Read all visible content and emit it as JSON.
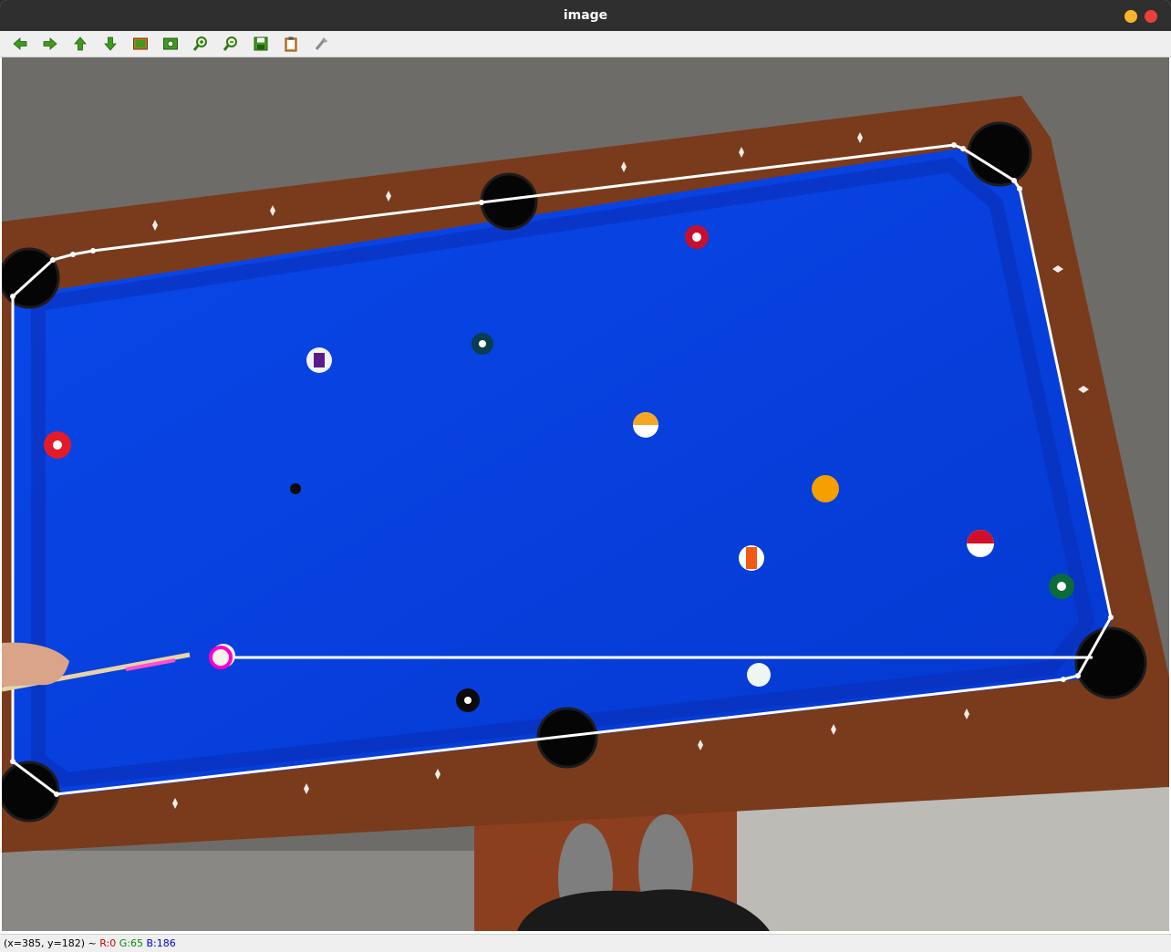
{
  "window": {
    "title": "image"
  },
  "toolbar": {
    "buttons": [
      {
        "name": "pan-left",
        "icon": "arrow-left-icon"
      },
      {
        "name": "pan-right",
        "icon": "arrow-right-icon"
      },
      {
        "name": "pan-up",
        "icon": "arrow-up-icon"
      },
      {
        "name": "pan-down",
        "icon": "arrow-down-icon"
      },
      {
        "name": "zoom-fit",
        "icon": "image-icon"
      },
      {
        "name": "zoom-original",
        "icon": "image-zoom-icon"
      },
      {
        "name": "zoom-in",
        "icon": "zoom-in-icon"
      },
      {
        "name": "zoom-out",
        "icon": "zoom-out-icon"
      },
      {
        "name": "save",
        "icon": "save-icon"
      },
      {
        "name": "copy",
        "icon": "clipboard-icon"
      },
      {
        "name": "properties",
        "icon": "brush-icon"
      }
    ]
  },
  "status": {
    "coords": "(x=385, y=182) ~",
    "r": "R:0",
    "g": "G:65",
    "b": "B:186"
  },
  "colors": {
    "felt": "#0a46e6",
    "rail": "#7a3a1c",
    "overlay_line": "#ffffff",
    "cue_marker": "#ff00c8"
  }
}
